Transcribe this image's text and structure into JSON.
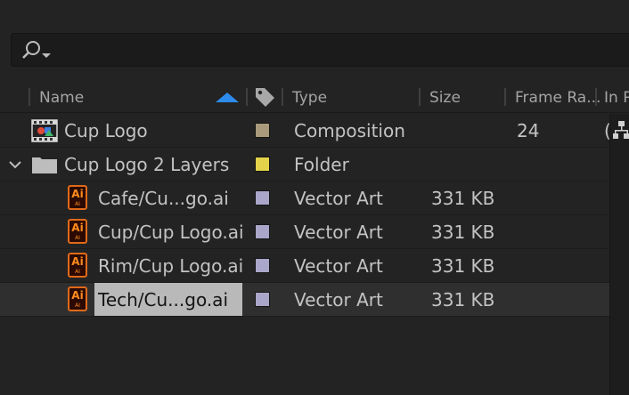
{
  "search": {
    "placeholder": ""
  },
  "header": {
    "name": "Name",
    "type": "Type",
    "size": "Size",
    "frame_rate": "Frame Ra...",
    "in_point": "In P"
  },
  "rows": [
    {
      "name": "Cup Logo",
      "type": "Composition",
      "size": "",
      "frame_rate": "24",
      "label_color": "#a89a7a",
      "icon": "composition-icon",
      "in_point": "("
    },
    {
      "name": "Cup Logo 2 Layers",
      "type": "Folder",
      "size": "",
      "frame_rate": "",
      "label_color": "#e3d24a",
      "icon": "folder-icon"
    },
    {
      "name": "Cafe/Cu...go.ai",
      "type": "Vector Art",
      "size": "331 KB",
      "frame_rate": "",
      "label_color": "#a9a6c9",
      "icon": "illustrator-file-icon",
      "icon_text": "Ai",
      "icon_sub": "AI"
    },
    {
      "name": "Cup/Cup Logo.ai",
      "type": "Vector Art",
      "size": "331 KB",
      "frame_rate": "",
      "label_color": "#a9a6c9",
      "icon": "illustrator-file-icon",
      "icon_text": "Ai",
      "icon_sub": "AI"
    },
    {
      "name": "Rim/Cup Logo.ai",
      "type": "Vector Art",
      "size": "331 KB",
      "frame_rate": "",
      "label_color": "#a9a6c9",
      "icon": "illustrator-file-icon",
      "icon_text": "Ai",
      "icon_sub": "AI"
    },
    {
      "name": "Tech/Cu...go.ai",
      "type": "Vector Art",
      "size": "331 KB",
      "frame_rate": "",
      "label_color": "#a9a6c9",
      "icon": "illustrator-file-icon",
      "icon_text": "Ai",
      "icon_sub": "AI",
      "selected": true
    }
  ],
  "colors": {
    "sort_arrow": "#2d8ceb",
    "ai_border": "#e06a19",
    "ai_text": "#ff8a1d"
  }
}
